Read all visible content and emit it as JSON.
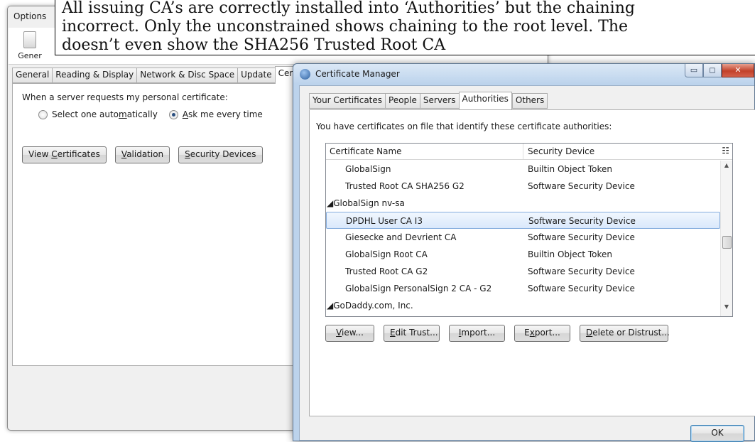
{
  "annotation": {
    "lines": [
      "All issuing CA’s are correctly installed into ‘Authorities’ but the chaining",
      "incorrect.  Only the unconstrained shows chaining to the root level.  The",
      "doesn’t even show the SHA256 Trusted Root CA"
    ]
  },
  "options": {
    "window_title": "Options",
    "toolbar_label": "Gener",
    "tabs": [
      "General",
      "Reading & Display",
      "Network & Disc Space",
      "Update",
      "Certificates"
    ],
    "active_tab": "Certificates",
    "prompt": "When a server requests my personal certificate:",
    "radio_auto": "Select one automatically",
    "radio_ask": "Ask me every time",
    "selected_radio": "Ask me every time",
    "buttons": {
      "view_certificates": "View Certificates",
      "validation": "Validation",
      "security_devices": "Security Devices"
    }
  },
  "cert_manager": {
    "title": "Certificate Manager",
    "window_controls": {
      "minimize": "▭",
      "maximize": "◻",
      "close": "✕"
    },
    "tabs": [
      "Your Certificates",
      "People",
      "Servers",
      "Authorities",
      "Others"
    ],
    "active_tab": "Authorities",
    "intro": "You have certificates on file that identify these certificate authorities:",
    "columns": {
      "name": "Certificate Name",
      "device": "Security Device"
    },
    "rows": [
      {
        "name": "GlobalSign",
        "device": "Builtin Object Token",
        "group": false
      },
      {
        "name": "Trusted Root CA SHA256 G2",
        "device": "Software Security Device",
        "group": false
      },
      {
        "name": "◢GlobalSign nv-sa",
        "device": "",
        "group": true
      },
      {
        "name": "DPDHL User CA I3",
        "device": "Software Security Device",
        "group": false,
        "selected": true
      },
      {
        "name": "Giesecke and Devrient CA",
        "device": "Software Security Device",
        "group": false
      },
      {
        "name": "GlobalSign Root CA",
        "device": "Builtin Object Token",
        "group": false
      },
      {
        "name": "Trusted Root CA G2",
        "device": "Software Security Device",
        "group": false
      },
      {
        "name": "GlobalSign PersonalSign 2 CA - G2",
        "device": "Software Security Device",
        "group": false
      },
      {
        "name": "◢GoDaddy.com, Inc.",
        "device": "",
        "group": true
      }
    ],
    "buttons": {
      "view": "View...",
      "edit_trust": "Edit Trust...",
      "import": "Import...",
      "export": "Export...",
      "delete": "Delete or Distrust...",
      "ok": "OK"
    }
  },
  "colors": {
    "selection_border": "#84acdd",
    "titlebar": "#bcd3ec",
    "close_button": "#c2412a"
  }
}
